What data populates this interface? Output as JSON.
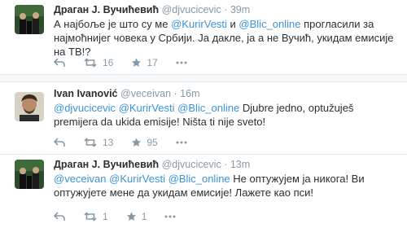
{
  "tweets": [
    {
      "fullname": "Драган Ј. Вучићевић",
      "username": "@djvucicevic",
      "dot": "·",
      "time": "39m",
      "text_segments": [
        {
          "t": "А најбоље је што су ме ",
          "m": false
        },
        {
          "t": "@KurirVesti",
          "m": true
        },
        {
          "t": " и ",
          "m": false
        },
        {
          "t": "@Blic_online",
          "m": true
        },
        {
          "t": " прогласили за најмоћнијег човека у Србији. Ја дакле, ја а не Вучић, укидам емисије на ТВ!?",
          "m": false
        }
      ],
      "retweets": "16",
      "favorites": "17",
      "icons": [
        "reply-icon",
        "retweet-icon",
        "favorite-icon",
        "more-icon"
      ]
    },
    {
      "fullname": "Ivan Ivanović",
      "username": "@veceivan",
      "dot": "·",
      "time": "16m",
      "text_segments": [
        {
          "t": "@djvucicevic",
          "m": true
        },
        {
          "t": " ",
          "m": false
        },
        {
          "t": "@KurirVesti",
          "m": true
        },
        {
          "t": " ",
          "m": false
        },
        {
          "t": "@Blic_online",
          "m": true
        },
        {
          "t": " Djubre jedno, optužuješ premijera da ukida emisije! Ništa ti nije sveto!",
          "m": false
        }
      ],
      "retweets": "13",
      "favorites": "95",
      "icons": [
        "reply-icon",
        "retweet-icon",
        "favorite-icon",
        "more-icon"
      ]
    },
    {
      "fullname": "Драган Ј. Вучићевић",
      "username": "@djvucicevic",
      "dot": "·",
      "time": "13m",
      "text_segments": [
        {
          "t": "@veceivan",
          "m": true
        },
        {
          "t": " ",
          "m": false
        },
        {
          "t": "@KurirVesti",
          "m": true
        },
        {
          "t": " ",
          "m": false
        },
        {
          "t": "@Blic_online",
          "m": true
        },
        {
          "t": " Не оптужујем ја никога! Ви оптужујете мене да укидам емисије! Лажете као пси!",
          "m": false
        }
      ],
      "retweets": "1",
      "favorites": "1",
      "icons": [
        "reply-icon",
        "retweet-icon",
        "favorite-icon",
        "more-icon"
      ]
    }
  ],
  "colors": {
    "mention": "#3b94d9",
    "muted": "#8899a6",
    "text": "#292f33",
    "background": "#f5f8fa",
    "card": "#ffffff"
  }
}
